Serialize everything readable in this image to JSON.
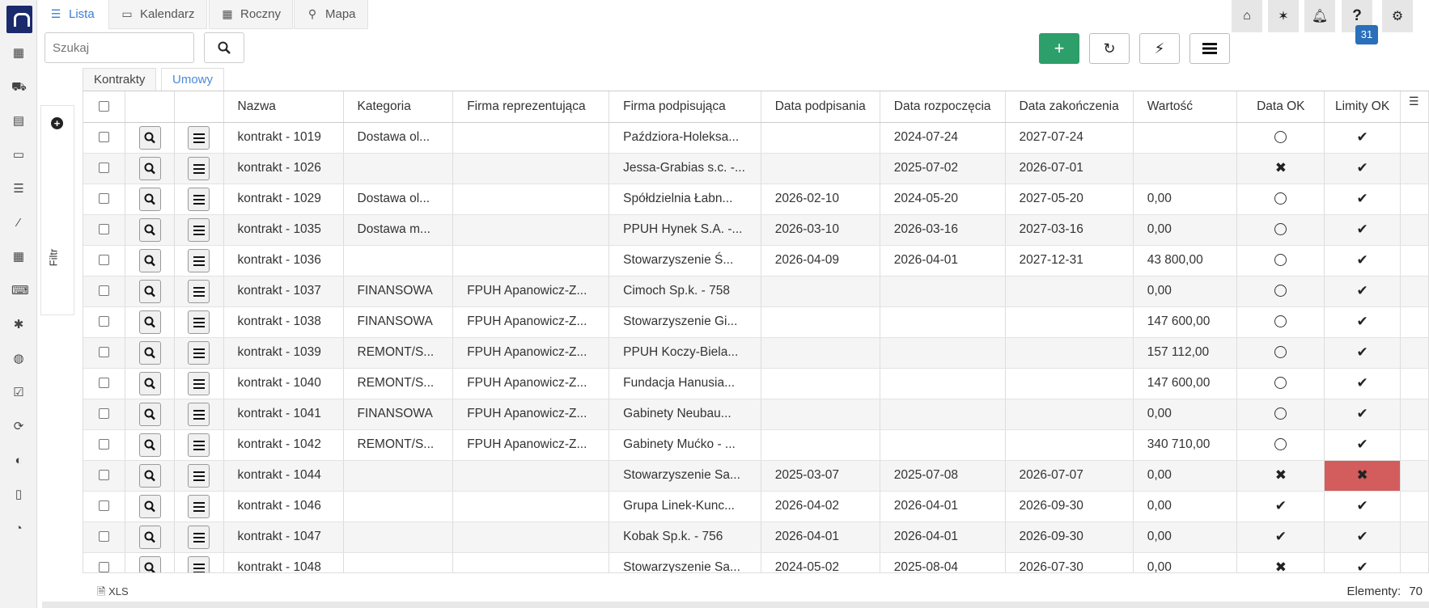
{
  "view_tabs": [
    "Lista",
    "Kalendarz",
    "Roczny",
    "Mapa"
  ],
  "notifications_count": "31",
  "search": {
    "placeholder": "Szukaj"
  },
  "filter_label": "Filtr",
  "sub_tabs": [
    "Kontrakty",
    "Umowy"
  ],
  "columns": [
    "Nazwa",
    "Kategoria",
    "Firma reprezentująca",
    "Firma podpisująca",
    "Data podpisania",
    "Data rozpoczęcia",
    "Data zakończenia",
    "Wartość",
    "Data OK",
    "Limity OK"
  ],
  "rows": [
    {
      "name": "kontrakt - 1019",
      "category": "Dostawa ol...",
      "rep": "",
      "signer": "Paździora-Holeksa...",
      "signed": "",
      "start": "2024-07-24",
      "end": "2027-07-24",
      "value": "",
      "data_ok": "circle",
      "limits_ok": "check"
    },
    {
      "name": "kontrakt - 1026",
      "category": "",
      "rep": "",
      "signer": "Jessa-Grabias s.c. -...",
      "signed": "",
      "start": "2025-07-02",
      "end": "2026-07-01",
      "value": "",
      "data_ok": "cross",
      "limits_ok": "check"
    },
    {
      "name": "kontrakt - 1029",
      "category": "Dostawa ol...",
      "rep": "",
      "signer": "Spółdzielnia Łabn...",
      "signed": "2026-02-10",
      "start": "2024-05-20",
      "end": "2027-05-20",
      "value": "0,00",
      "data_ok": "circle",
      "limits_ok": "check"
    },
    {
      "name": "kontrakt - 1035",
      "category": "Dostawa m...",
      "rep": "",
      "signer": "PPUH Hynek S.A. -...",
      "signed": "2026-03-10",
      "start": "2026-03-16",
      "end": "2027-03-16",
      "value": "0,00",
      "data_ok": "circle",
      "limits_ok": "check"
    },
    {
      "name": "kontrakt - 1036",
      "category": "",
      "rep": "",
      "signer": "Stowarzyszenie Ś...",
      "signed": "2026-04-09",
      "start": "2026-04-01",
      "end": "2027-12-31",
      "value": "43 800,00",
      "data_ok": "circle",
      "limits_ok": "check"
    },
    {
      "name": "kontrakt - 1037",
      "category": "FINANSOWA",
      "rep": "FPUH Apanowicz-Z...",
      "signer": "Cimoch Sp.k. - 758",
      "signed": "",
      "start": "",
      "end": "",
      "value": "0,00",
      "data_ok": "circle",
      "limits_ok": "check"
    },
    {
      "name": "kontrakt - 1038",
      "category": "FINANSOWA",
      "rep": "FPUH Apanowicz-Z...",
      "signer": "Stowarzyszenie Gi...",
      "signed": "",
      "start": "",
      "end": "",
      "value": "147 600,00",
      "data_ok": "circle",
      "limits_ok": "check"
    },
    {
      "name": "kontrakt - 1039",
      "category": "REMONT/S...",
      "rep": "FPUH Apanowicz-Z...",
      "signer": "PPUH Koczy-Biela...",
      "signed": "",
      "start": "",
      "end": "",
      "value": "157 112,00",
      "data_ok": "circle",
      "limits_ok": "check"
    },
    {
      "name": "kontrakt - 1040",
      "category": "REMONT/S...",
      "rep": "FPUH Apanowicz-Z...",
      "signer": "Fundacja Hanusia...",
      "signed": "",
      "start": "",
      "end": "",
      "value": "147 600,00",
      "data_ok": "circle",
      "limits_ok": "check"
    },
    {
      "name": "kontrakt - 1041",
      "category": "FINANSOWA",
      "rep": "FPUH Apanowicz-Z...",
      "signer": "Gabinety Neubau...",
      "signed": "",
      "start": "",
      "end": "",
      "value": "0,00",
      "data_ok": "circle",
      "limits_ok": "check"
    },
    {
      "name": "kontrakt - 1042",
      "category": "REMONT/S...",
      "rep": "FPUH Apanowicz-Z...",
      "signer": "Gabinety Mućko - ...",
      "signed": "",
      "start": "",
      "end": "",
      "value": "340 710,00",
      "data_ok": "circle",
      "limits_ok": "check"
    },
    {
      "name": "kontrakt - 1044",
      "category": "",
      "rep": "",
      "signer": "Stowarzyszenie Sa...",
      "signed": "2025-03-07",
      "start": "2025-07-08",
      "end": "2026-07-07",
      "value": "0,00",
      "data_ok": "cross",
      "limits_ok": "cross-bad"
    },
    {
      "name": "kontrakt - 1046",
      "category": "",
      "rep": "",
      "signer": "Grupa Linek-Kunc...",
      "signed": "2026-04-02",
      "start": "2026-04-01",
      "end": "2026-09-30",
      "value": "0,00",
      "data_ok": "check",
      "limits_ok": "check"
    },
    {
      "name": "kontrakt - 1047",
      "category": "",
      "rep": "",
      "signer": "Kobak Sp.k. - 756",
      "signed": "2026-04-01",
      "start": "2026-04-01",
      "end": "2026-09-30",
      "value": "0,00",
      "data_ok": "check",
      "limits_ok": "check"
    },
    {
      "name": "kontrakt - 1048",
      "category": "",
      "rep": "",
      "signer": "Stowarzyszenie Sa...",
      "signed": "2024-05-02",
      "start": "2025-08-04",
      "end": "2026-07-30",
      "value": "0,00",
      "data_ok": "cross",
      "limits_ok": "check"
    }
  ],
  "footer": {
    "export_label": "XLS",
    "count_label": "Elementy:",
    "count_value": "70"
  },
  "colors": {
    "accent": "#3a7fd5",
    "add_button": "#2d9f6a",
    "bad_cell": "#d35c5c",
    "badge": "#2a6fbb"
  },
  "icons": {
    "sidebar": [
      "building-icon",
      "truck-icon",
      "warehouse-icon",
      "money-icon",
      "layers-icon",
      "brush-icon",
      "city-icon",
      "terminal-icon",
      "bug-icon",
      "globe-icon",
      "checkbox-icon",
      "refresh-icon",
      "user-icon",
      "document-icon",
      "gauge-icon"
    ],
    "top": [
      "home-icon",
      "magic-wand-icon",
      "bell-icon",
      "help-icon",
      "gear-icon"
    ]
  }
}
